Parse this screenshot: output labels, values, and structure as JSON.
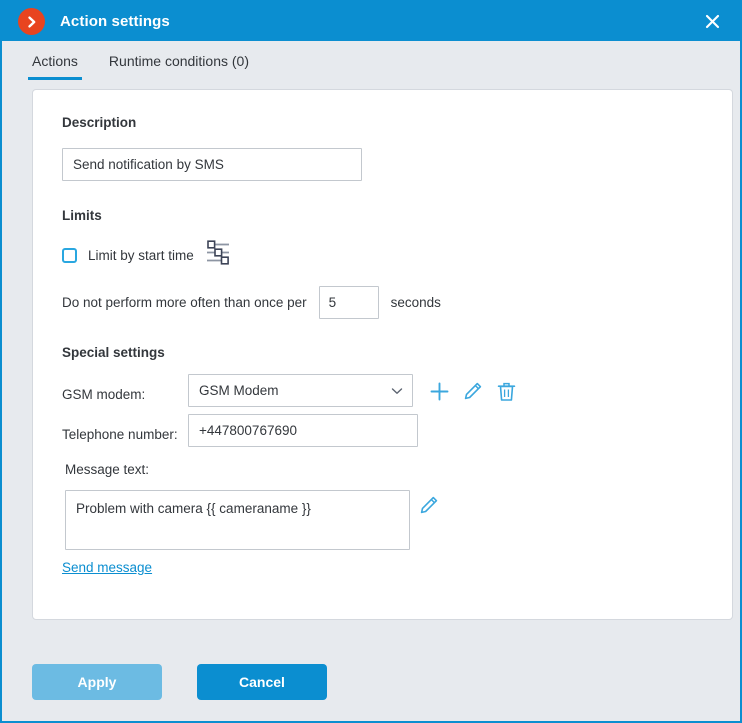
{
  "window": {
    "title": "Action settings",
    "app_icon": "chevron-right-circle-icon",
    "close_icon": "close-icon",
    "titlebar_color": "#0b8ed0",
    "app_icon_color": "#e8441f"
  },
  "tabs": [
    {
      "label": "Actions",
      "active": true
    },
    {
      "label": "Runtime conditions (0)",
      "active": false
    }
  ],
  "description": {
    "section_title": "Description",
    "value": "Send notification by SMS",
    "placeholder": ""
  },
  "limits": {
    "section_title": "Limits",
    "limit_by_start_time_label": "Limit by start time",
    "limit_by_start_time_checked": false,
    "slider_icon": "sliders-icon",
    "frequency_label": "Do not perform more often than once per",
    "frequency_value": "5",
    "frequency_suffix": "seconds"
  },
  "special_settings": {
    "section_title": "Special settings",
    "gsm_modem_label": "GSM modem:",
    "gsm_modem_value": "GSM Modem",
    "gsm_modem_options": [
      "GSM Modem"
    ],
    "add_icon": "plus-icon",
    "edit_icon": "pencil-icon",
    "delete_icon": "trash-icon",
    "phone_label": "Telephone number:",
    "phone_value": "+447800767690",
    "message_label": "Message text:",
    "message_value": "Problem with camera {{ cameraname }}",
    "message_edit_icon": "pencil-icon",
    "send_message_link": "Send message"
  },
  "footer": {
    "apply_label": "Apply",
    "cancel_label": "Cancel",
    "apply_color": "#6cbbe3",
    "cancel_color": "#0b8ed0"
  }
}
